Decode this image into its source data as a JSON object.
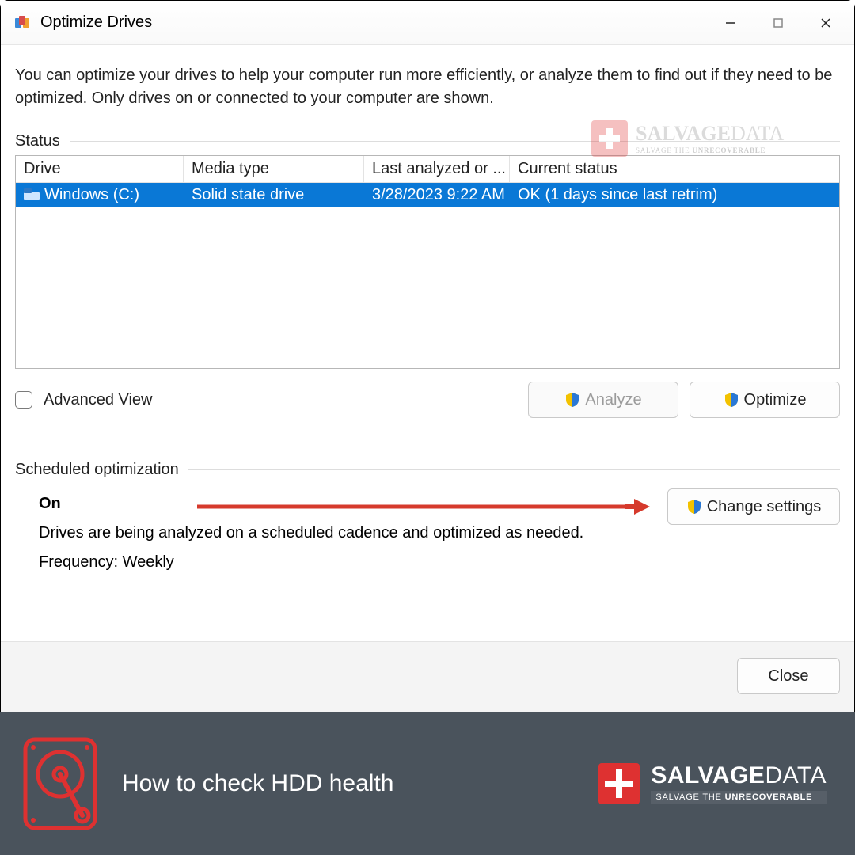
{
  "window": {
    "title": "Optimize Drives",
    "description": "You can optimize your drives to help your computer run more efficiently, or analyze them to find out if they need to be optimized. Only drives on or connected to your computer are shown."
  },
  "status": {
    "section_label": "Status",
    "headers": {
      "drive": "Drive",
      "media_type": "Media type",
      "last_analyzed": "Last analyzed or ...",
      "current_status": "Current status"
    },
    "rows": [
      {
        "drive": "Windows (C:)",
        "media_type": "Solid state drive",
        "last_analyzed": "3/28/2023 9:22 AM",
        "current_status": "OK (1 days since last retrim)"
      }
    ]
  },
  "actions": {
    "advanced_view": "Advanced View",
    "analyze": "Analyze",
    "optimize": "Optimize"
  },
  "scheduled": {
    "section_label": "Scheduled optimization",
    "status": "On",
    "description": "Drives are being analyzed on a scheduled cadence and optimized as needed.",
    "frequency": "Frequency: Weekly",
    "change_settings": "Change settings"
  },
  "footer": {
    "close": "Close"
  },
  "banner": {
    "caption": "How to check HDD health",
    "brand_bold": "SALVAGE",
    "brand_light": "DATA",
    "tagline_pre": "SALVAGE THE ",
    "tagline_bold": "UNRECOVERABLE"
  }
}
